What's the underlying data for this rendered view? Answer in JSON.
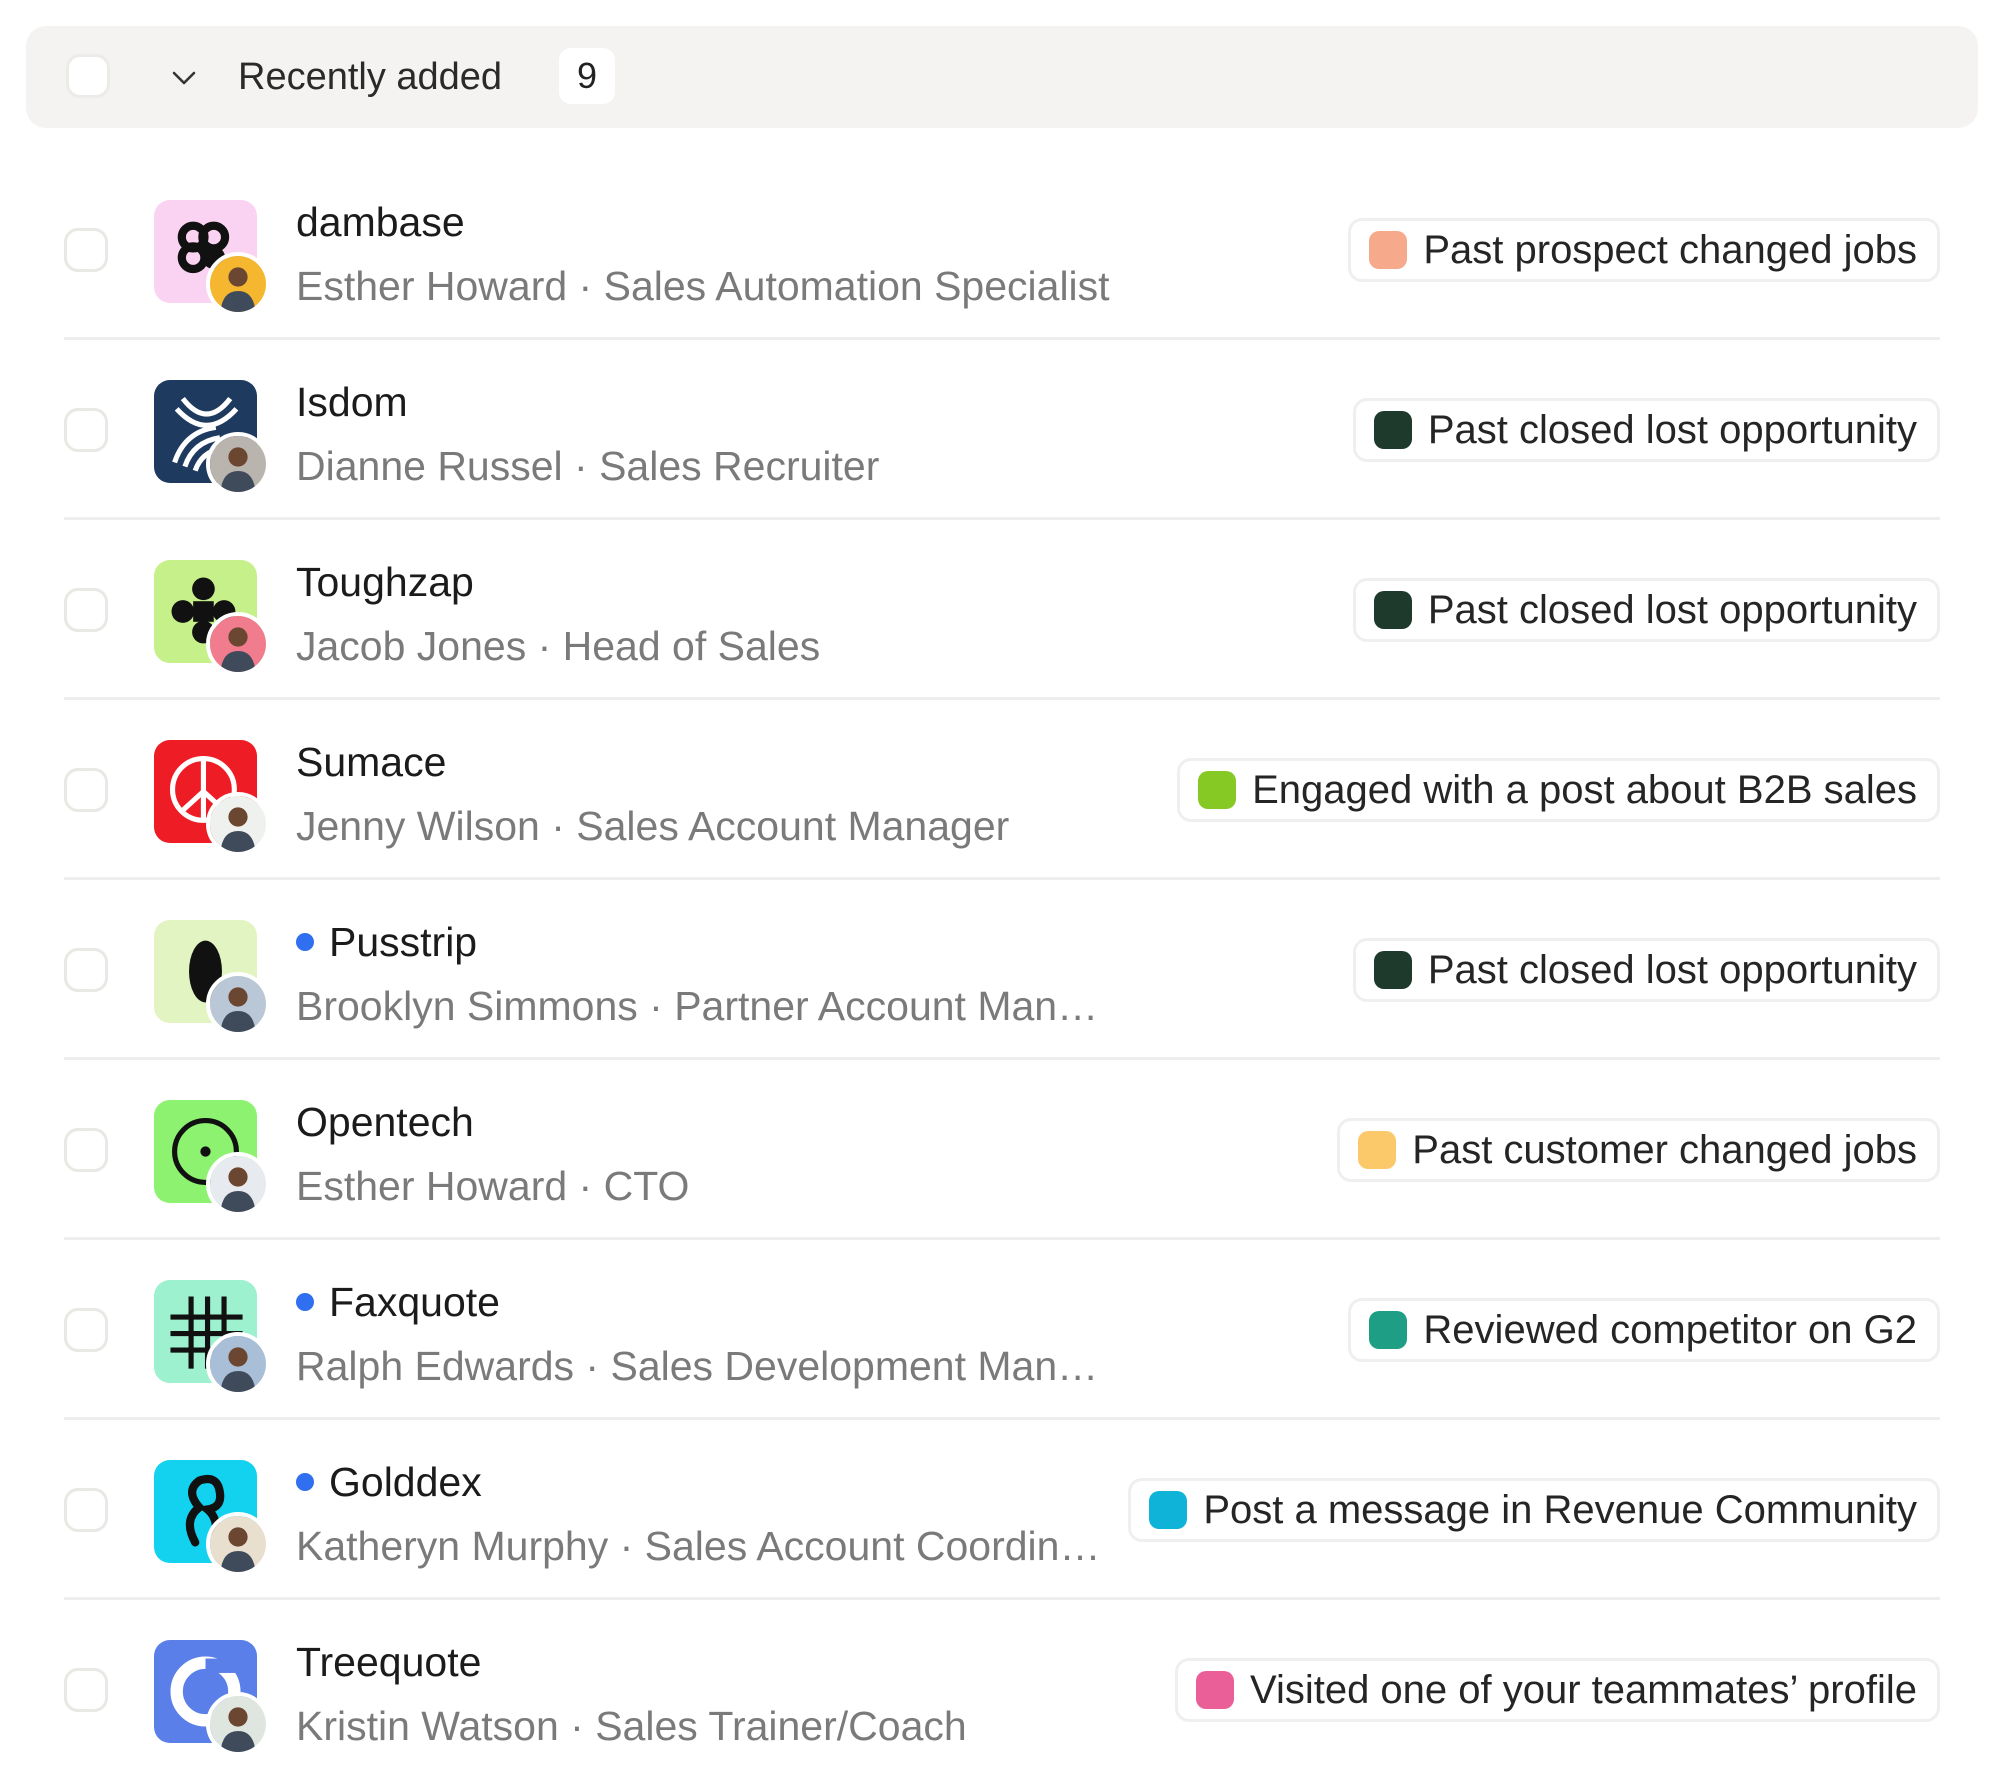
{
  "group": {
    "label": "Recently added",
    "count": "9"
  },
  "rows": [
    {
      "company": "dambase",
      "person": "Esther Howard · Sales Automation Specialist",
      "tag": "Past prospect changed jobs",
      "tag_color": "#f7a98c",
      "logo_bg": "#fbd3f2",
      "logo_fg": "#111111",
      "logo_icon": "knot-logo",
      "avatar_bg": "#f5b730",
      "is_new": false
    },
    {
      "company": "Isdom",
      "person": "Dianne Russel · Sales Recruiter",
      "tag": "Past closed lost opportunity",
      "tag_color": "#1d3a2c",
      "logo_bg": "#1f3a5f",
      "logo_fg": "#ffffff",
      "logo_icon": "arcs-logo",
      "avatar_bg": "#b9b4ad",
      "is_new": false
    },
    {
      "company": "Toughzap",
      "person": "Jacob Jones · Head of Sales",
      "tag": "Past closed lost opportunity",
      "tag_color": "#1d3a2c",
      "logo_bg": "#c6f08a",
      "logo_fg": "#111111",
      "logo_icon": "clover-logo",
      "avatar_bg": "#f07c8e",
      "is_new": false
    },
    {
      "company": "Sumace",
      "person": "Jenny Wilson · Sales Account Manager",
      "tag": "Engaged with a post about B2B sales",
      "tag_color": "#86c925",
      "logo_bg": "#ee1c24",
      "logo_fg": "#ffffff",
      "logo_icon": "peace-logo",
      "avatar_bg": "#eef1ee",
      "is_new": false
    },
    {
      "company": "Pusstrip",
      "person": "Brooklyn Simmons · Partner Account Manager",
      "tag": "Past closed lost opportunity",
      "tag_color": "#1d3a2c",
      "logo_bg": "#e2f4c2",
      "logo_fg": "#111111",
      "logo_icon": "drop-logo",
      "avatar_bg": "#b9c7d6",
      "is_new": true
    },
    {
      "company": "Opentech",
      "person": "Esther Howard · CTO",
      "tag": "Past customer changed jobs",
      "tag_color": "#fbc96a",
      "logo_bg": "#8cf26f",
      "logo_fg": "#111111",
      "logo_icon": "circle-dot-logo",
      "avatar_bg": "#e7eaee",
      "is_new": false
    },
    {
      "company": "Faxquote",
      "person": "Ralph Edwards · Sales Development Manager",
      "tag": "Reviewed competitor on G2",
      "tag_color": "#1f9e86",
      "logo_bg": "#9df1cf",
      "logo_fg": "#111111",
      "logo_icon": "grid-logo",
      "avatar_bg": "#a9bfd8",
      "is_new": true
    },
    {
      "company": "Golddex",
      "person": "Katheryn Murphy · Sales Account Coordin…",
      "tag": "Post a message in Revenue Community",
      "tag_color": "#10b3d8",
      "logo_bg": "#12d2ef",
      "logo_fg": "#111111",
      "logo_icon": "loop-logo",
      "avatar_bg": "#e9dfcf",
      "is_new": true
    },
    {
      "company": "Treequote",
      "person": "Kristin Watson · Sales Trainer/Coach",
      "tag": "Visited one of your teammates’ profile",
      "tag_color": "#eb5f98",
      "logo_bg": "#5b7fe8",
      "logo_fg": "#ffffff",
      "logo_icon": "ring-logo",
      "avatar_bg": "#dfe6df",
      "is_new": false
    }
  ]
}
